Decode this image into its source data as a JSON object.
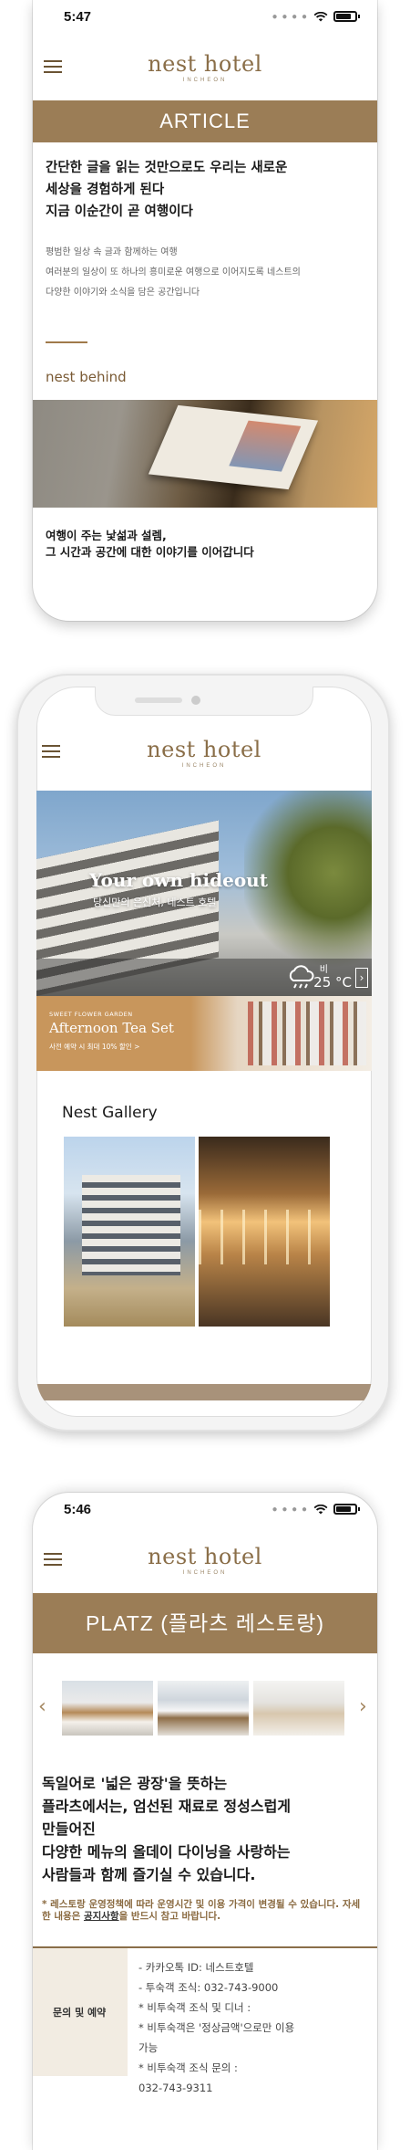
{
  "phone1": {
    "time": "5:47",
    "logo": "nest hotel",
    "logo_sub": "INCHEON",
    "banner": "ARTICLE",
    "headline": [
      "간단한 글을 읽는 것만으로도 우리는 새로운",
      "세상을 경험하게 된다",
      "지금 이순간이 곧 여행이다"
    ],
    "desc": [
      "평범한 일상 속 글과 함께하는 여행",
      "여러분의 일상이 또 하나의 흥미로운 여행으로 이어지도록 네스트의",
      "다양한 이야기와 소식을 담은 공간입니다"
    ],
    "section": "nest behind",
    "caption": [
      "여행이 주는 낯섦과 설렘,",
      "그 시간과 공간에 대한 이야기를 이어갑니다"
    ]
  },
  "phone2": {
    "logo": "nest hotel",
    "logo_sub": "INCHEON",
    "hero_title": "Your own hideout",
    "hero_sub": "당신만의 은신처, 네스트 호텔",
    "weather_label": "비",
    "weather_temp": "25 °C",
    "promo_eyebrow": "SWEET FLOWER GARDEN",
    "promo_title": "Afternoon Tea Set",
    "promo_sub": "사전 예약 시 최대 10% 할인 >",
    "gallery_title": "Nest Gallery"
  },
  "phone3": {
    "time": "5:46",
    "logo": "nest hotel",
    "logo_sub": "INCHEON",
    "banner": "PLATZ (플라츠 레스토랑)",
    "headline": [
      "독일어로 '넓은 광장'을 뜻하는",
      "플라츠에서는, 엄선된 재료로 정성스럽게",
      "만들어진",
      "다양한 메뉴의 올데이 다이닝을 사랑하는",
      "사람들과 함께 즐기실 수 있습니다."
    ],
    "notice_pre": "* 레스토랑 운영정책에 따라 운영시간 및 이용 가격이 변경될 수 있습니다. 자세한 내용은 ",
    "notice_link": "공지사항",
    "notice_post": "을 반드시 참고 바랍니다.",
    "table_label": "문의 및 예약",
    "table_lines": [
      "- 카카오톡 ID: 네스트호텔",
      "- 투숙객 조식: 032-743-9000",
      "* 비투숙객 조식 및 디너 :",
      "* 비투숙객은 '정상금액'으로만 이용",
      "가능",
      "* 비투숙객 조식 문의 :",
      "032-743-9311"
    ]
  }
}
